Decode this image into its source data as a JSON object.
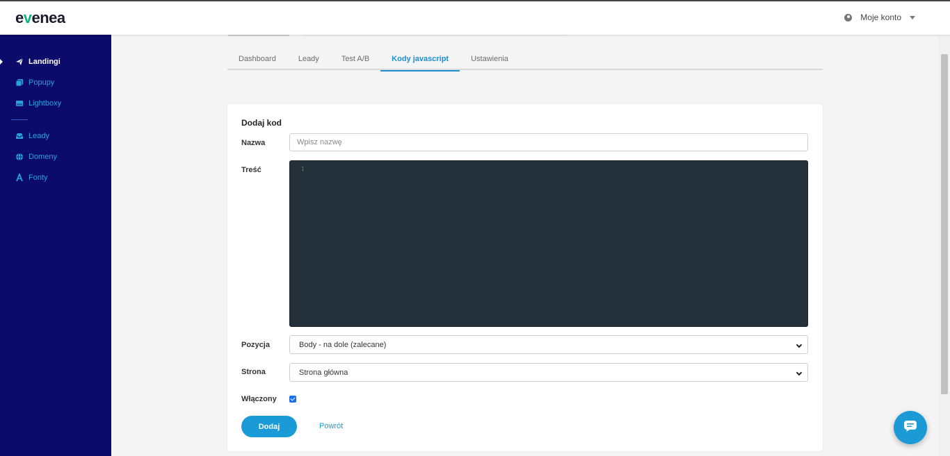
{
  "brand": {
    "logo_pre": "e",
    "logo_v": "v",
    "logo_post": "enea",
    "accent": "#14b37d"
  },
  "header": {
    "account_label": "Moje konto"
  },
  "sidebar": {
    "items": [
      {
        "label": "Landingi",
        "icon": "paper-plane-icon",
        "active": true
      },
      {
        "label": "Popupy",
        "icon": "popup-icon"
      },
      {
        "label": "Lightboxy",
        "icon": "lightbox-icon"
      },
      {
        "label": "Leady",
        "icon": "inbox-icon"
      },
      {
        "label": "Domeny",
        "icon": "globe-icon"
      },
      {
        "label": "Fonty",
        "icon": "font-icon"
      }
    ],
    "background": "#0a0b6b",
    "link_color": "#29a3e0"
  },
  "tabs": [
    {
      "label": "Dashboard"
    },
    {
      "label": "Leady"
    },
    {
      "label": "Test A/B"
    },
    {
      "label": "Kody javascript",
      "active": true
    },
    {
      "label": "Ustawienia"
    }
  ],
  "form": {
    "title": "Dodaj kod",
    "name_label": "Nazwa",
    "name_placeholder": "Wpisz nazwę",
    "name_value": "",
    "content_label": "Treść",
    "editor_line_number": "1",
    "position_label": "Pozycja",
    "position_value": "Body - na dole (zalecane)",
    "page_label": "Strona",
    "page_value": "Strona główna",
    "enabled_label": "Włączony",
    "enabled_checked": true,
    "submit_label": "Dodaj",
    "back_label": "Powrót"
  },
  "colors": {
    "primary": "#1a9ad6",
    "editor_bg": "#24303a"
  }
}
